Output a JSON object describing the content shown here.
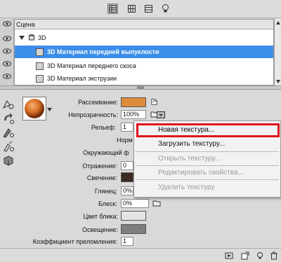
{
  "toolbar": {
    "icons": [
      "scene-icon",
      "mesh-icon",
      "material-icon",
      "light-icon"
    ]
  },
  "scene": {
    "header": "Сцена",
    "root": "3D",
    "items": [
      {
        "label": "3D Материал передней выпуклости",
        "selected": true
      },
      {
        "label": "3D Материал переднего скоса",
        "selected": false
      },
      {
        "label": "3D Материал экструзии",
        "selected": false
      }
    ]
  },
  "material": {
    "diffuse_label": "Рассеивание:",
    "diffuse_color": "#e08a3c",
    "opacity_label": "Непрозрачность:",
    "opacity_value": "100%",
    "relief_label": "Рельеф:",
    "relief_value": "1",
    "normals_label": "Норм",
    "environment_label": "Окружающий ф",
    "reflection_label": "Отражение:",
    "reflection_value": "0",
    "glow_label": "Свечение:",
    "glow_color": "#3a2a22",
    "gloss_label": "Глянец:",
    "gloss_value": "0%",
    "shine_label": "Блеск:",
    "shine_value": "0%",
    "specular_label": "Цвет блика:",
    "specular_color": "#e4e4e4",
    "illumination_label": "Освещение:",
    "illumination_color": "#666666",
    "refraction_label": "Коэффициент преломления:",
    "refraction_value": "1"
  },
  "menu": {
    "items": [
      {
        "label": "Новая текстура...",
        "enabled": true,
        "highlighted": true
      },
      {
        "label": "Загрузить текстуру...",
        "enabled": true
      },
      {
        "label": "Открыть текстуру...",
        "enabled": false
      },
      {
        "label": "Редактировать свойства...",
        "enabled": false
      },
      {
        "label": "Удалить текстуру",
        "enabled": false
      }
    ],
    "highlight_color": "#e0141c"
  },
  "colors": {
    "selection": "#3b8ee8"
  }
}
